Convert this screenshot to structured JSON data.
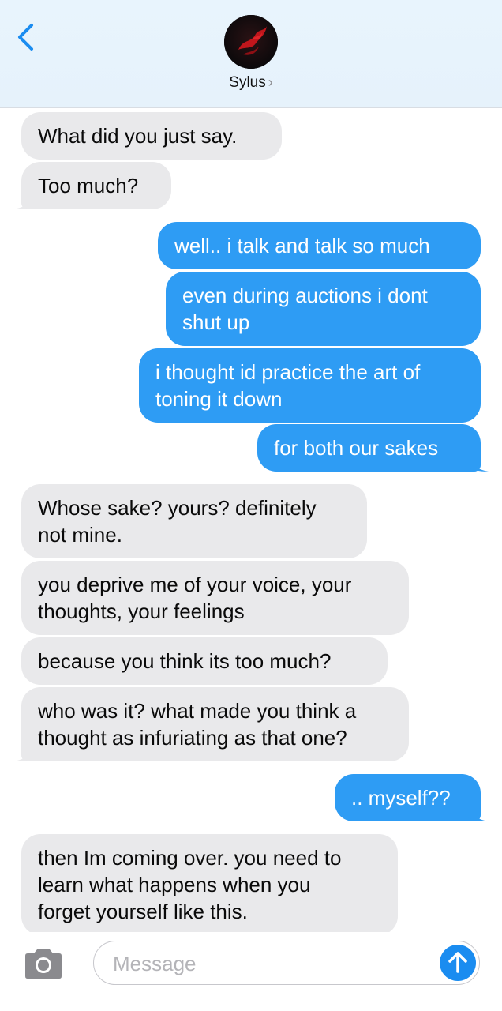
{
  "header": {
    "back_icon": "chevron-left-icon",
    "contact_name": "Sylus",
    "contact_chevron": "›"
  },
  "messages": [
    {
      "dir": "in",
      "lines": [
        "What did you just say."
      ]
    },
    {
      "dir": "in",
      "lines": [
        "Too much?"
      ],
      "tail": true
    },
    {
      "dir": "out",
      "lines": [
        "well.. i talk and talk so much"
      ]
    },
    {
      "dir": "out",
      "lines": [
        "even during auctions i dont",
        "shut up"
      ]
    },
    {
      "dir": "out",
      "lines": [
        "i thought id practice the art of",
        "toning it down"
      ]
    },
    {
      "dir": "out",
      "lines": [
        "for both our sakes"
      ],
      "tail": true
    },
    {
      "dir": "in",
      "lines": [
        "Whose sake? yours? definitely",
        "not mine."
      ]
    },
    {
      "dir": "in",
      "lines": [
        "you deprive me of your voice, your",
        "thoughts, your feelings"
      ]
    },
    {
      "dir": "in",
      "lines": [
        "because you think its too much?"
      ]
    },
    {
      "dir": "in",
      "lines": [
        "who was it? what made you think a",
        "thought as infuriating as that one?"
      ],
      "tail": true
    },
    {
      "dir": "out",
      "lines": [
        ".. myself??"
      ],
      "tail": true
    },
    {
      "dir": "in",
      "lines": [
        "then Im coming over. you need to",
        "learn what happens when you",
        "forget yourself like this."
      ]
    }
  ],
  "composer": {
    "camera_icon": "camera-icon",
    "placeholder": "Message",
    "send_icon": "arrow-up-icon"
  },
  "colors": {
    "incoming_bubble": "#e9e9eb",
    "outgoing_bubble": "#2e9cf4",
    "accent": "#1a8cf0",
    "header_bg": "#e8f4fd"
  }
}
